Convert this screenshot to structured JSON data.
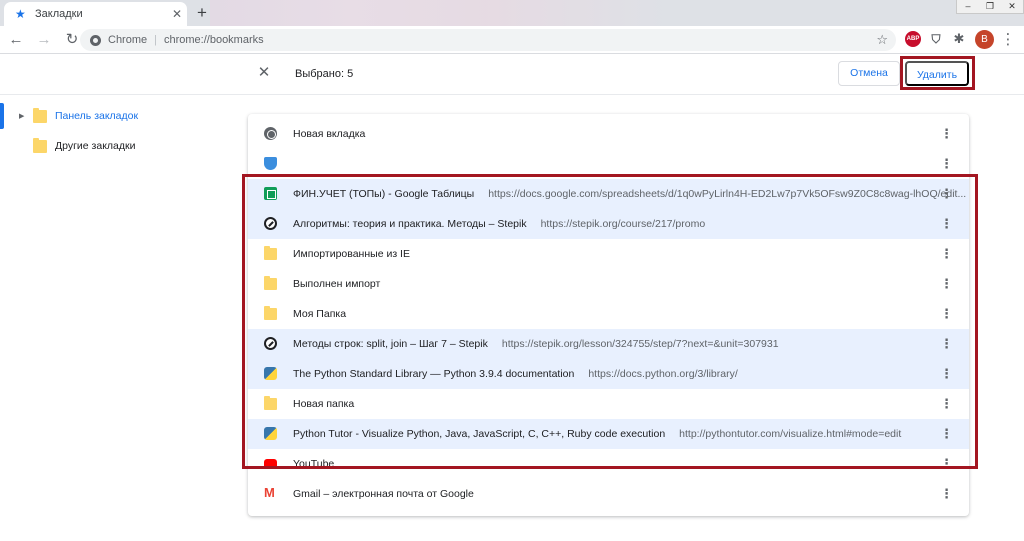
{
  "tab": {
    "title": "Закладки",
    "close": "✕",
    "icon": "star-icon"
  },
  "newtab": "+",
  "window_controls": [
    "–",
    "❐",
    "✕"
  ],
  "toolbar": {
    "back": "←",
    "forward": "→",
    "reload": "↻",
    "omnibox_chip": "Chrome",
    "omnibox_sep": "|",
    "omnibox_url": "chrome://bookmarks",
    "star": "☆",
    "extensions": {
      "abp": "ABP",
      "shield": "⛉",
      "puzzle": "✱"
    },
    "avatar": "В",
    "menu": "⋮"
  },
  "selection": {
    "close": "✕",
    "count": "Выбрано: 5",
    "cancel": "Отмена",
    "delete": "Удалить"
  },
  "tree": [
    {
      "label": "Панель закладок",
      "active": true,
      "arrow": "▶"
    },
    {
      "label": "Другие закладки",
      "active": false
    }
  ],
  "bookmarks": [
    {
      "icon": "globe",
      "title": "Новая вкладка",
      "url": "",
      "selected": false
    },
    {
      "icon": "shield",
      "title": "",
      "url": "",
      "selected": false
    },
    {
      "icon": "sheets",
      "title": "ФИН.УЧЕТ (ТОПы) - Google Таблицы",
      "url": "https://docs.google.com/spreadsheets/d/1q0wPyLirln4H-ED2Lw7p7Vk5OFsw9Z0C8c8wag-lhOQ/edit...",
      "selected": true
    },
    {
      "icon": "stepik",
      "title": "Алгоритмы: теория и практика. Методы – Stepik",
      "url": "https://stepik.org/course/217/promo",
      "selected": true
    },
    {
      "icon": "folder",
      "title": "Импортированные из IE",
      "url": "",
      "selected": false
    },
    {
      "icon": "folder",
      "title": "Выполнен импорт",
      "url": "",
      "selected": false
    },
    {
      "icon": "folder",
      "title": "Моя Папка",
      "url": "",
      "selected": false
    },
    {
      "icon": "stepik",
      "title": "Методы строк: split, join – Шаг 7 – Stepik",
      "url": "https://stepik.org/lesson/324755/step/7?next=&unit=307931",
      "selected": true
    },
    {
      "icon": "python",
      "title": "The Python Standard Library — Python 3.9.4 documentation",
      "url": "https://docs.python.org/3/library/",
      "selected": true
    },
    {
      "icon": "folder",
      "title": "Новая папка",
      "url": "",
      "selected": false
    },
    {
      "icon": "python",
      "title": "Python Tutor - Visualize Python, Java, JavaScript, C, C++, Ruby code execution",
      "url": "http://pythontutor.com/visualize.html#mode=edit",
      "selected": true
    },
    {
      "icon": "youtube",
      "title": "YouTube",
      "url": "",
      "selected": false
    },
    {
      "icon": "gmail",
      "title": "Gmail – электронная почта от Google",
      "url": "",
      "selected": false
    }
  ],
  "row_menu": "⋮",
  "colors": {
    "accent": "#1a73e8",
    "selected_row": "#e8f0fe",
    "highlight": "#a31621",
    "folder": "#fcd669"
  }
}
